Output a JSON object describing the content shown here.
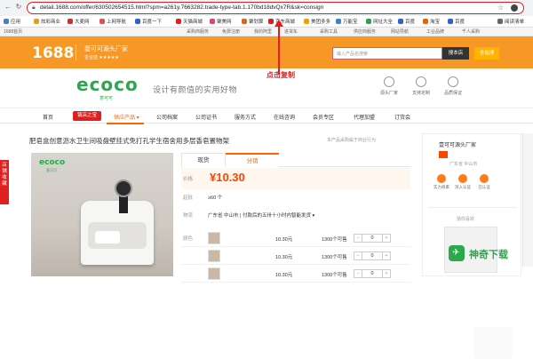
{
  "browser": {
    "url": "detail.1688.com/offer/630502654515.html?spm=a261y.7663282.trade-type-tab.1.170bd18dvQx7R&sk=consign",
    "bookmarks": [
      {
        "label": "应用",
        "color": "#4a7bd0"
      },
      {
        "label": "炫彩商业",
        "color": "#e0a020"
      },
      {
        "label": "大麦网",
        "color": "#d03030"
      },
      {
        "label": "上网导航",
        "color": "#e05050"
      },
      {
        "label": "百度一下",
        "color": "#3060d0"
      },
      {
        "label": "天猫商城",
        "color": "#e02020"
      },
      {
        "label": "聚美网",
        "color": "#e04080"
      },
      {
        "label": "聚划算",
        "color": "#e06020"
      },
      {
        "label": "京东商城",
        "color": "#d02020"
      },
      {
        "label": "美团多多",
        "color": "#f0a000"
      },
      {
        "label": "万能宝",
        "color": "#4080d0"
      },
      {
        "label": "网址大全",
        "color": "#30a050"
      },
      {
        "label": "百度",
        "color": "#3060d0"
      },
      {
        "label": "淘宝",
        "color": "#f06000"
      },
      {
        "label": "百度",
        "color": "#3060d0"
      },
      {
        "label": "阅读清单",
        "color": "#666666"
      }
    ]
  },
  "toplinks": [
    "1688首页",
    "采购商服务",
    "免费注册",
    "我的阿里",
    "进货车",
    "采购工具",
    "供应商服务",
    "网站导航",
    "工业品牌",
    "千人采购"
  ],
  "shop_header": {
    "logo": "1688",
    "shop_name": "壹可可源头厂家",
    "shop_sub": "企业店 ★★★★★",
    "search_placeholder": "输入产品名搜索",
    "search_button": "搜本店",
    "search_all_button": "全站搜"
  },
  "banner": {
    "brand": "ecoco",
    "brand_sub": "意可可",
    "slogan": "设计有颜值的实用好物",
    "annotation": "点击复制",
    "services": [
      "源头厂家",
      "支持定制",
      "品质保证"
    ]
  },
  "shop_nav": {
    "items": [
      "首页",
      "全部产品",
      "公司档案",
      "公司证书",
      "服务方式",
      "在线咨询",
      "会员专区",
      "代理加盟",
      "订货会"
    ],
    "badge": "镇店之宝",
    "active": "供应产品 ▾"
  },
  "product": {
    "title": "肥皂盒创意沥水卫生间吸盘壁挂式免打孔学生宿舍用多层香皂置物架",
    "meta": "本产品采购属于商业行为",
    "image_logo": "ecoco",
    "image_logo_sub": "意可可",
    "tabs": [
      "现货",
      "分销"
    ],
    "price_label": "价格",
    "price": "¥10.30",
    "sales_label": "起批",
    "sales_value": "≥60 个",
    "ship_label": "物流",
    "ship_value": "广东省 中山市 | 付款后的五卅十小时内智能发货 ▾",
    "color_label": "颜色",
    "sku_rows": [
      {
        "price": "10.30元",
        "stock": "1300个可售",
        "qty": "0"
      },
      {
        "price": "10.30元",
        "stock": "1300个可售",
        "qty": "0"
      },
      {
        "price": "10.30元",
        "stock": "1300个可售",
        "qty": "0"
      }
    ]
  },
  "shop_card": {
    "name": "壹可可源头厂家",
    "location": "广东省 中山市",
    "icons": [
      "实力商家",
      "深入认证",
      "已认证"
    ],
    "recommend": "猜你喜欢"
  },
  "left_tab": "店铺收藏",
  "watermark": {
    "text": "神奇下载",
    "glyph": "✈"
  }
}
